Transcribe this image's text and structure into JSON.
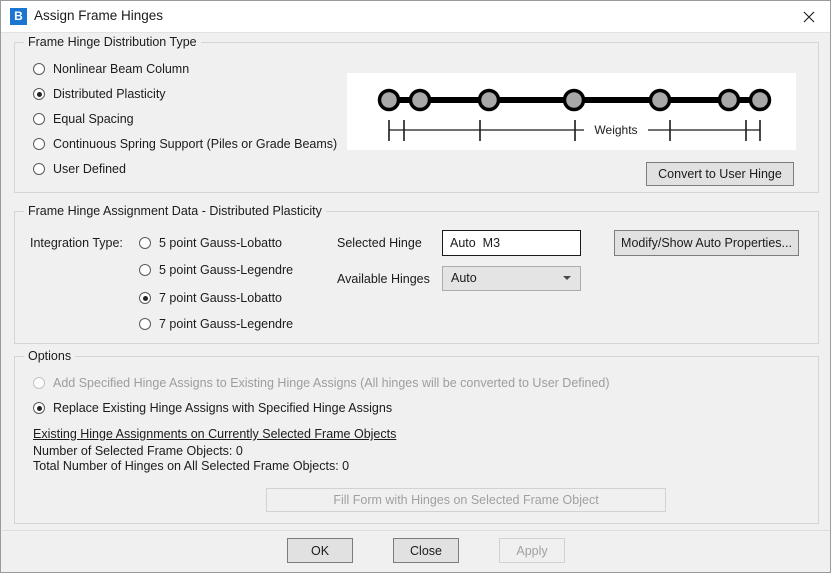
{
  "window": {
    "title": "Assign Frame Hinges",
    "app_icon_letter": "B",
    "close_icon": "close-icon"
  },
  "distribution_group": {
    "title": "Frame Hinge Distribution Type",
    "options": [
      {
        "label": "Nonlinear Beam Column",
        "checked": false
      },
      {
        "label": "Distributed Plasticity",
        "checked": true
      },
      {
        "label": "Equal Spacing",
        "checked": false
      },
      {
        "label": "Continuous Spring Support (Piles or Grade Beams)",
        "checked": false
      },
      {
        "label": "User Defined",
        "checked": false
      }
    ],
    "convert_button": "Convert to User Hinge",
    "diagram": {
      "caption": "Weights",
      "node_count": 7
    }
  },
  "assignment_group": {
    "title": "Frame Hinge Assignment Data - Distributed Plasticity",
    "integration_label": "Integration Type:",
    "integration_options": [
      {
        "label": "5 point Gauss-Lobatto",
        "checked": false
      },
      {
        "label": "5 point Gauss-Legendre",
        "checked": false
      },
      {
        "label": "7 point Gauss-Lobatto",
        "checked": true
      },
      {
        "label": "7 point Gauss-Legendre",
        "checked": false
      }
    ],
    "selected_hinge_label": "Selected Hinge",
    "selected_hinge_value": "Auto  M3",
    "available_hinges_label": "Available Hinges",
    "available_hinges_value": "Auto",
    "available_hinges_options": [
      "Auto"
    ],
    "modify_button": "Modify/Show Auto Properties..."
  },
  "options_group": {
    "title": "Options",
    "options": [
      {
        "label": "Add Specified Hinge Assigns to Existing Hinge Assigns  (All hinges will be converted to User Defined)",
        "checked": false,
        "disabled": true
      },
      {
        "label": "Replace Existing Hinge Assigns with Specified Hinge Assigns",
        "checked": true,
        "disabled": false
      }
    ],
    "existing_heading": "Existing Hinge Assignments on Currently Selected Frame Objects",
    "num_selected_frames": "Number of Selected Frame Objects:  0",
    "total_hinges": "Total Number of Hinges on All Selected Frame Objects:  0",
    "fill_form_button": "Fill Form with Hinges on Selected Frame Object"
  },
  "footer": {
    "ok_button": "OK",
    "close_button": "Close",
    "apply_button": "Apply"
  },
  "chart_data": {
    "type": "scatter",
    "title": "Weights",
    "xlabel": "",
    "ylabel": "",
    "series": [
      {
        "name": "7 point Gauss-Lobatto integration points",
        "x": [
          0.0,
          0.075,
          0.243,
          0.5,
          0.757,
          0.925,
          1.0
        ],
        "y": [
          0,
          0,
          0,
          0,
          0,
          0,
          0
        ]
      }
    ],
    "tick_positions": [
      0.0,
      0.04,
      0.245,
      0.5,
      0.755,
      0.96,
      0.985,
      1.0
    ],
    "grid": false,
    "legend": "none"
  }
}
